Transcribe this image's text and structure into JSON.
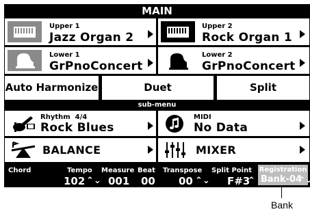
{
  "header": {
    "title": "MAIN"
  },
  "tones": {
    "upper1": {
      "label": "Upper 1",
      "name": "Jazz Organ 2"
    },
    "upper2": {
      "label": "Upper 2",
      "name": "Rock Organ 1"
    },
    "lower1": {
      "label": "Lower 1",
      "name": "GrPnoConcert"
    },
    "lower2": {
      "label": "Lower 2",
      "name": "GrPnoConcert"
    }
  },
  "modes": {
    "auto_harmonize": "Auto Harmonize",
    "duet": "Duet",
    "split": "Split"
  },
  "submenu": {
    "label": "sub-menu",
    "rhythm": {
      "label": "Rhythm",
      "meter": "4/4",
      "name": "Rock Blues"
    },
    "midi": {
      "label": "MIDI",
      "name": "No Data"
    },
    "balance": "BALANCE",
    "mixer": "MIXER"
  },
  "status": {
    "chord": {
      "label": "Chord",
      "value": ""
    },
    "tempo": {
      "label": "Tempo",
      "value": "102"
    },
    "measure": {
      "label": "Measure",
      "value": "001"
    },
    "beat": {
      "label": "Beat",
      "value": "00"
    },
    "transpose": {
      "label": "Transpose",
      "value": "00"
    },
    "split_point": {
      "label": "Split Point",
      "value": "F#3"
    },
    "registration": {
      "label": "Registration",
      "value": "Bank-04"
    }
  },
  "callout": {
    "label": "Bank"
  }
}
